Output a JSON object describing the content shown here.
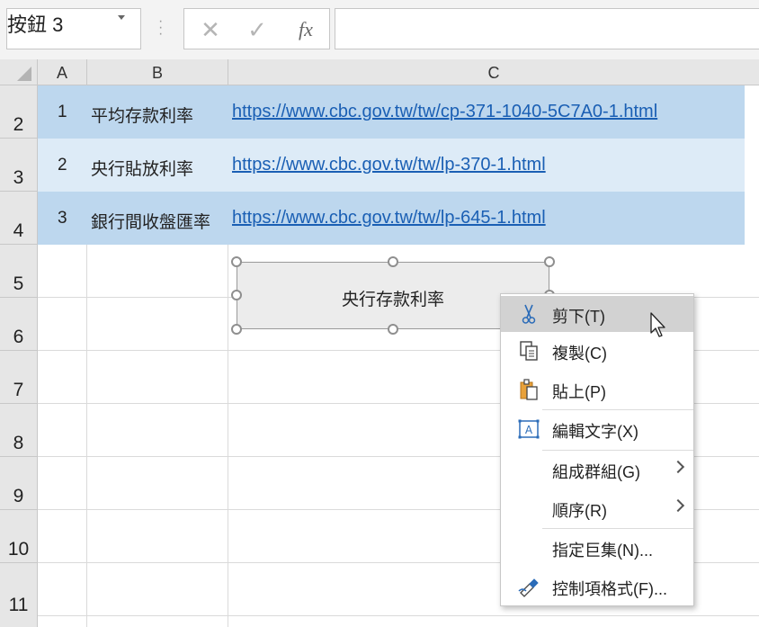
{
  "formula_bar": {
    "name_box": "按鈕 3",
    "cancel_icon": "✕",
    "enter_icon": "✓",
    "fx_label": "fx",
    "formula_value": ""
  },
  "columns": [
    "A",
    "B",
    "C"
  ],
  "rows": [
    "2",
    "3",
    "4",
    "5",
    "6",
    "7",
    "8",
    "9",
    "10",
    "11"
  ],
  "table": [
    {
      "num": "1",
      "name": "平均存款利率",
      "url": "https://www.cbc.gov.tw/tw/cp-371-1040-5C7A0-1.html"
    },
    {
      "num": "2",
      "name": "央行貼放利率",
      "url": "https://www.cbc.gov.tw/tw/lp-370-1.html"
    },
    {
      "num": "3",
      "name": "銀行間收盤匯率",
      "url": "https://www.cbc.gov.tw/tw/lp-645-1.html"
    }
  ],
  "shape": {
    "label": "央行存款利率"
  },
  "context_menu": [
    {
      "label": "剪下(T)",
      "icon": "scissors-icon"
    },
    {
      "label": "複製(C)",
      "icon": "copy-icon"
    },
    {
      "label": "貼上(P)",
      "icon": "paste-icon"
    },
    {
      "label": "編輯文字(X)",
      "icon": "edit-text-icon"
    },
    {
      "label": "組成群組(G)",
      "icon": ""
    },
    {
      "label": "順序(R)",
      "icon": ""
    },
    {
      "label": "指定巨集(N)...",
      "icon": ""
    },
    {
      "label": "控制項格式(F)...",
      "icon": "format-control-icon"
    }
  ],
  "colors": {
    "band_dark": "#bdd7ee",
    "band_light": "#ddebf7",
    "link": "#1a5fb4",
    "menu_hover": "#d2d2d2"
  }
}
